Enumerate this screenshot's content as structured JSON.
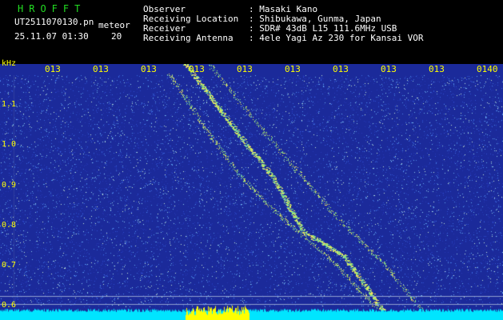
{
  "header": {
    "logo": "HROFFT",
    "filename": "UT2511070130.pn",
    "mode": "meteor",
    "datetime": "25.11.07 01:30",
    "count": "20",
    "fields": [
      {
        "label": "Observer",
        "value": ": Masaki Kano"
      },
      {
        "label": "Receiving Location",
        "value": ": Shibukawa, Gunma, Japan"
      },
      {
        "label": "Receiver",
        "value": ": SDR# 43dB L15 111.6MHz USB"
      },
      {
        "label": "Receiving Antenna",
        "value": ": 4ele Yagi Az 230 for Kansai VOR"
      }
    ]
  },
  "time_ticks": [
    "013",
    "013",
    "013",
    "013",
    "013",
    "013",
    "013",
    "013",
    "013",
    "0140"
  ],
  "freq_axis": {
    "unit": "kHz",
    "ticks": [
      "1.1",
      "1.0",
      "0.9",
      "0.8",
      "0.7",
      "0.6"
    ]
  },
  "colors": {
    "background": "#1b2a9a",
    "trace": "#a6e86a",
    "tick_text": "#ffff00",
    "logo": "#22dd22",
    "baseline": "#00e5ff",
    "burst": "#ffff00"
  }
}
